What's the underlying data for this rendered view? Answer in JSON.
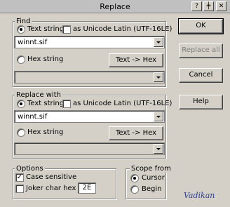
{
  "window": {
    "title": "Replace",
    "controls": [
      "?",
      "pin",
      "x"
    ]
  },
  "find": {
    "group_label": "Find",
    "text_string_label": "Text string",
    "unicode_label": "as Unicode Latin (UTF-16LE)",
    "text_value": "winnt.sif",
    "hex_string_label": "Hex string",
    "text_to_hex_label": "Text -> Hex",
    "hex_value": ""
  },
  "replace": {
    "group_label": "Replace with",
    "text_string_label": "Text string",
    "unicode_label": "as Unicode Latin (UTF-16LE)",
    "text_value": "winnt.sif",
    "hex_string_label": "Hex string",
    "text_to_hex_label": "Text -> Hex",
    "hex_value": ""
  },
  "options": {
    "group_label": "Options",
    "case_sensitive_label": "Case sensitive",
    "joker_label": "Joker char hex",
    "joker_value": "2E"
  },
  "scope": {
    "group_label": "Scope from",
    "cursor_label": "Cursor",
    "begin_label": "Begin"
  },
  "buttons": {
    "ok": "OK",
    "replace_all": "Replace all",
    "cancel": "Cancel",
    "help": "Help"
  },
  "signature": "Vadikan",
  "icons": {
    "pin": "pin-icon",
    "close": "close-icon",
    "help": "help-icon"
  }
}
